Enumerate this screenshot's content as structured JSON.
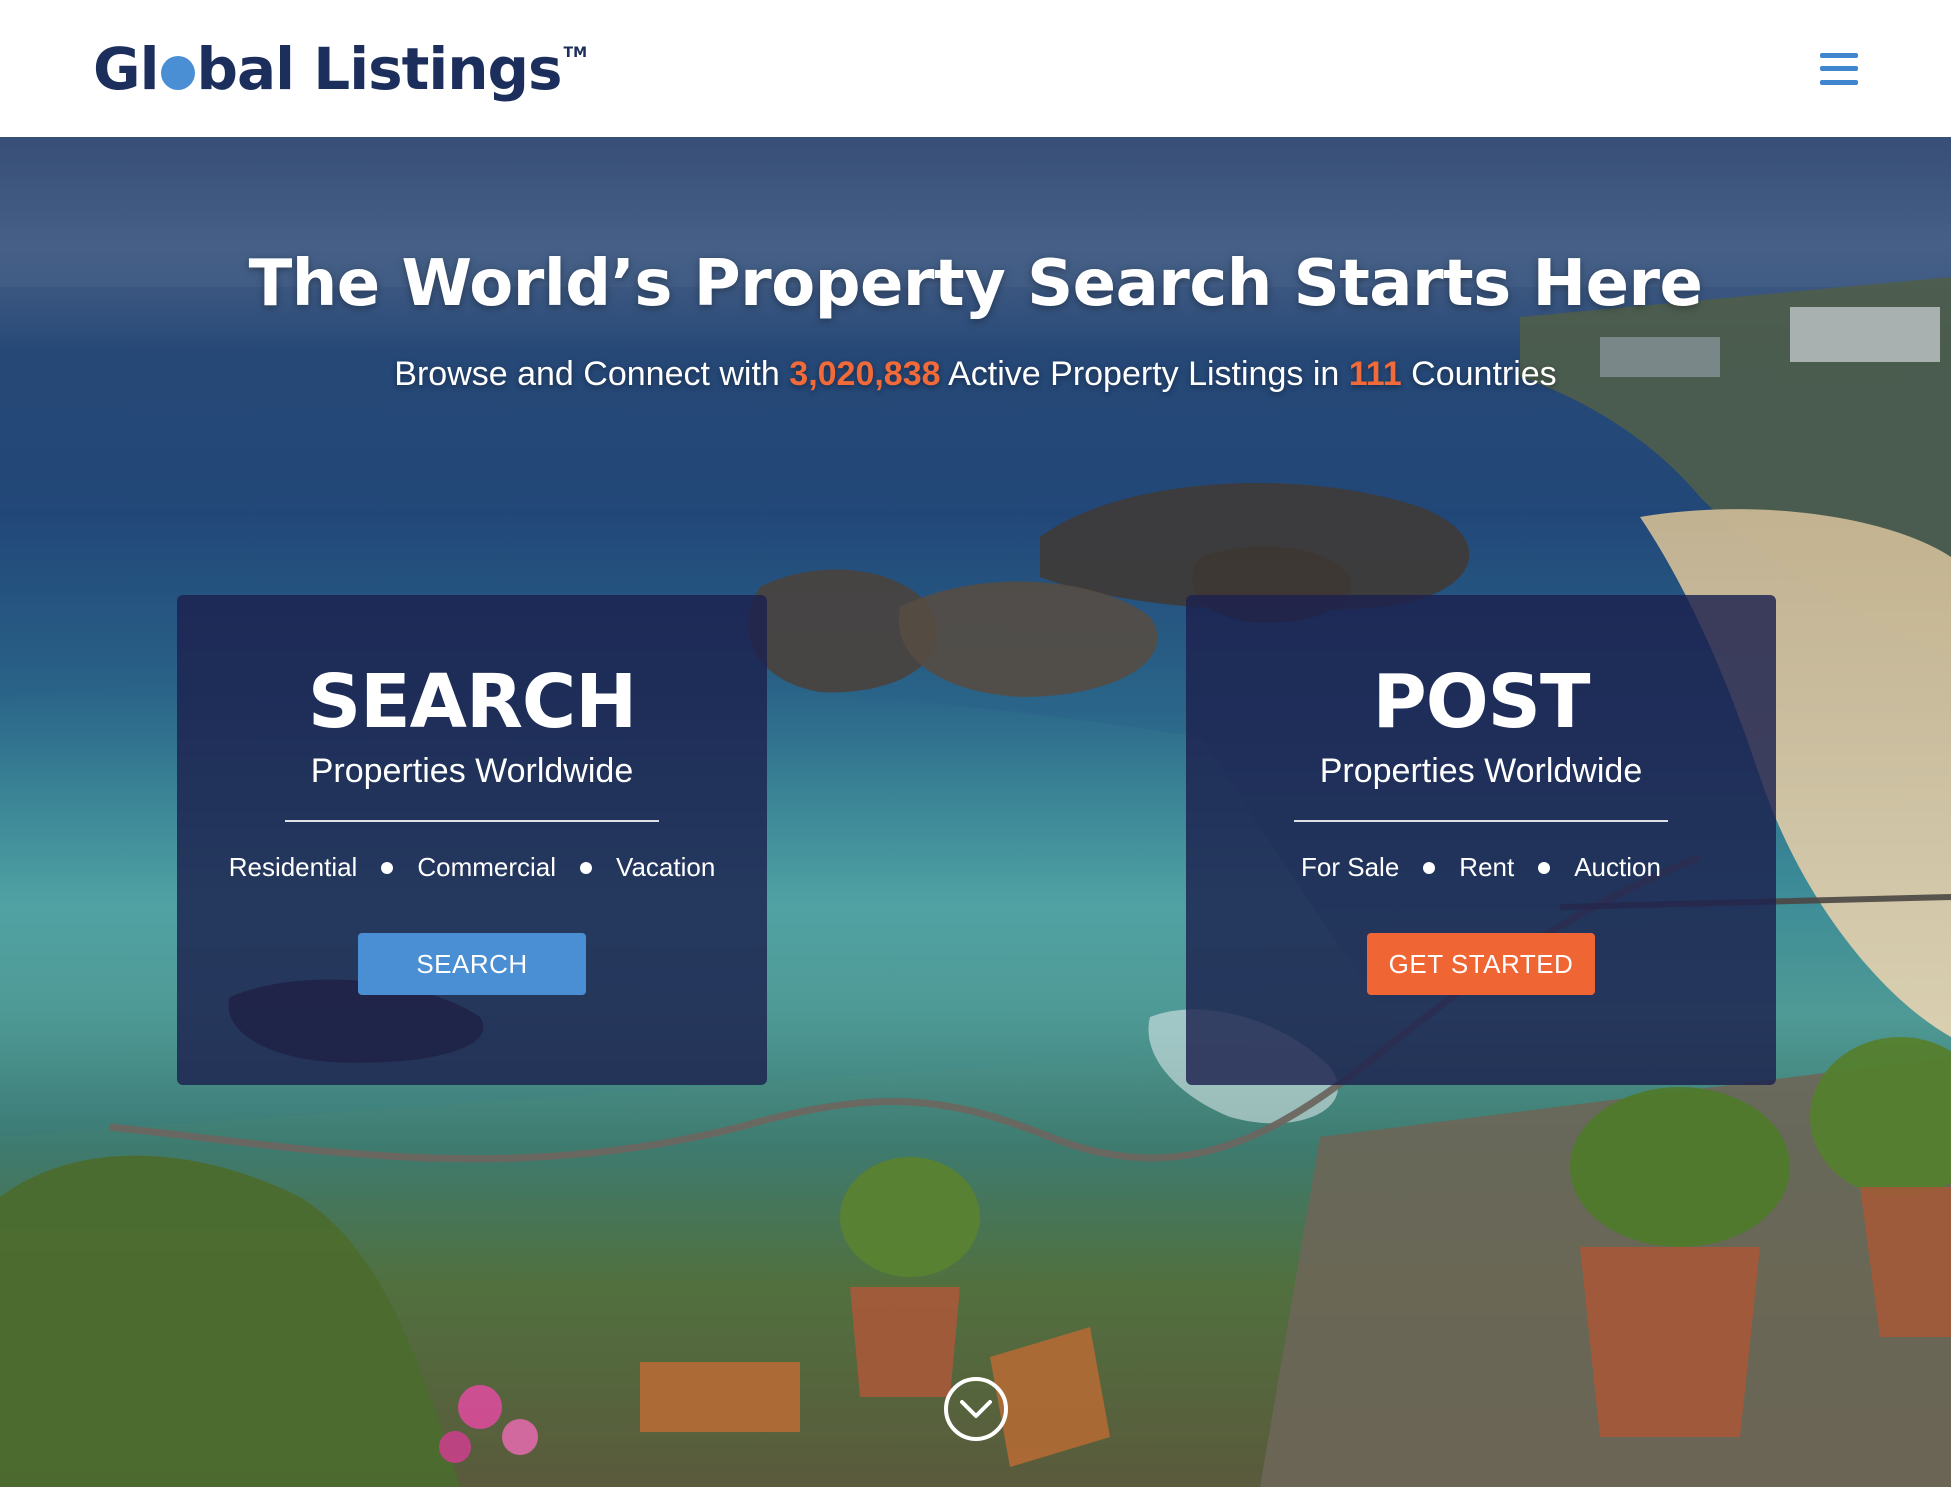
{
  "header": {
    "logo": {
      "part1": "Gl",
      "part2": "bal Listings",
      "trademark": "TM"
    },
    "menu_icon": "hamburger-menu-icon"
  },
  "hero": {
    "title": "The World’s Property Search Starts Here",
    "subtitle": {
      "prefix": "Browse and Connect with ",
      "listings_count": "3,020,838",
      "middle": " Active Property Listings in ",
      "countries_count": "111",
      "suffix": " Countries"
    },
    "scroll_icon": "chevron-down-circle-icon"
  },
  "cards": {
    "search": {
      "heading": "SEARCH",
      "subheading": "Properties Worldwide",
      "types": [
        "Residential",
        "Commercial",
        "Vacation"
      ],
      "button_label": "SEARCH"
    },
    "post": {
      "heading": "POST",
      "subheading": "Properties Worldwide",
      "types": [
        "For Sale",
        "Rent",
        "Auction"
      ],
      "button_label": "GET STARTED"
    }
  },
  "colors": {
    "brand_navy": "#1c2f5c",
    "brand_blue": "#4a8fd4",
    "accent_orange": "#ef6534",
    "card_overlay": "#1c214e"
  }
}
